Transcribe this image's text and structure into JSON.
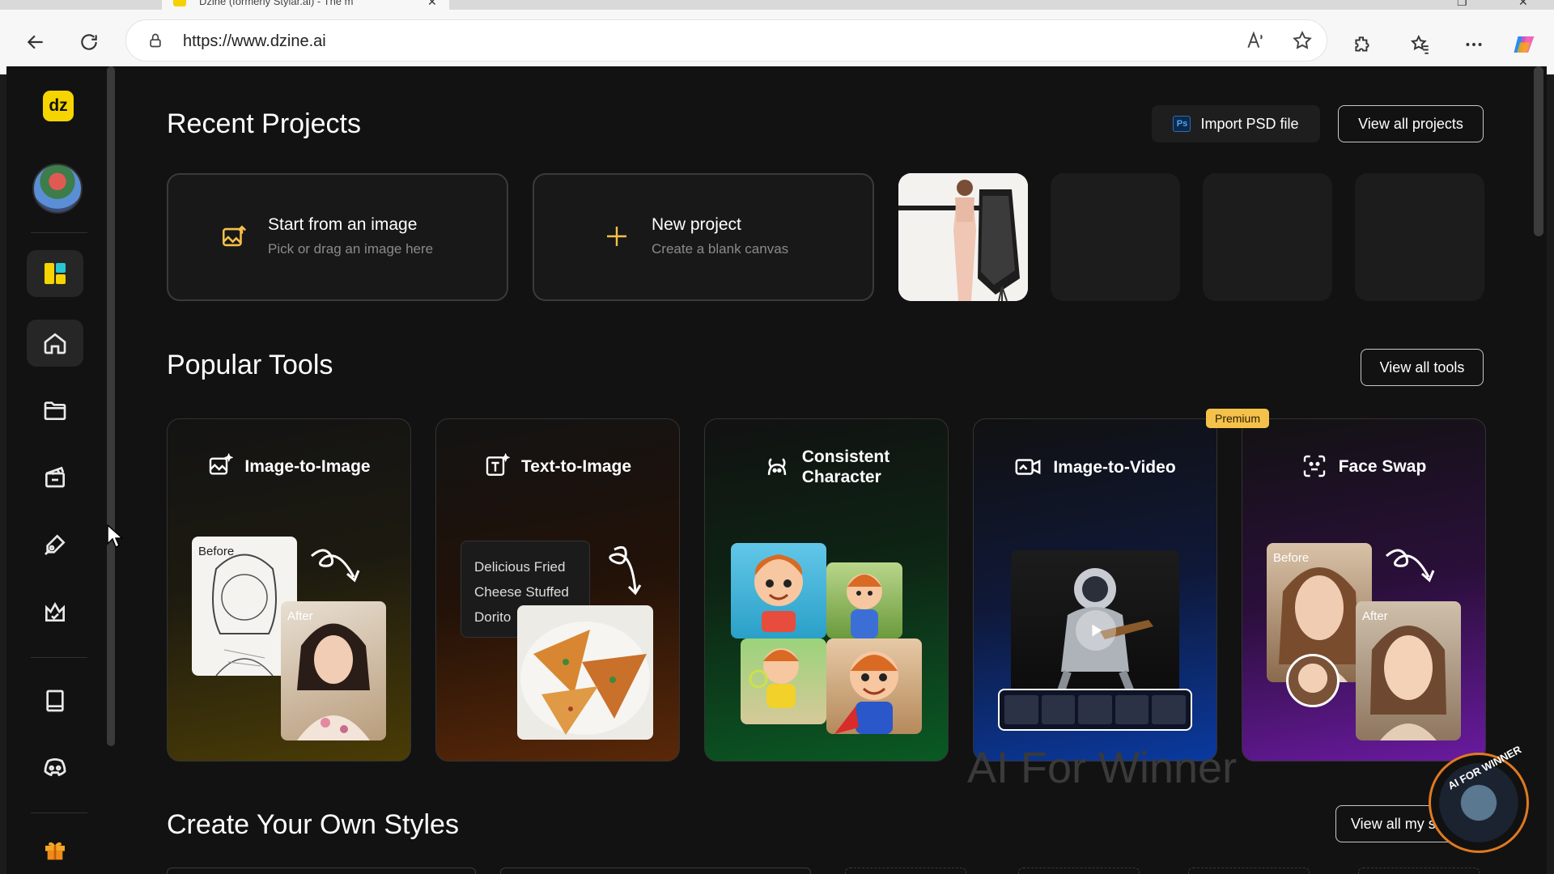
{
  "browser": {
    "tab_title": "Dzine (formerly Stylar.ai) - The m",
    "url": "https://www.dzine.ai"
  },
  "sidebar": {
    "logo": "dz",
    "items": [
      {
        "name": "canvas-app",
        "icon": "dzine-canvas-icon"
      },
      {
        "name": "home",
        "icon": "home-icon"
      },
      {
        "name": "projects",
        "icon": "folder-icon"
      },
      {
        "name": "tools",
        "icon": "clapperboard-icon"
      },
      {
        "name": "styles",
        "icon": "pen-tool-icon"
      },
      {
        "name": "community",
        "icon": "crown-icon"
      },
      {
        "name": "tutorials",
        "icon": "book-icon"
      },
      {
        "name": "discord",
        "icon": "discord-icon"
      },
      {
        "name": "gift",
        "icon": "gift-icon"
      }
    ]
  },
  "recent": {
    "title": "Recent Projects",
    "import_label": "Import PSD file",
    "import_badge": "Ps",
    "view_all": "View all projects",
    "start_title": "Start from an image",
    "start_sub": "Pick or drag an image here",
    "new_title": "New project",
    "new_sub": "Create a blank canvas"
  },
  "tools": {
    "title": "Popular Tools",
    "view_all": "View all tools",
    "premium": "Premium",
    "cards": [
      {
        "label": "Image-to-Image",
        "before": "Before",
        "after": "After"
      },
      {
        "label": "Text-to-Image",
        "prompt": [
          "Delicious Fried",
          "Cheese Stuffed",
          "Dorito"
        ]
      },
      {
        "label": "Consistent",
        "label2": "Character"
      },
      {
        "label": "Image-to-Video"
      },
      {
        "label": "Face Swap",
        "before": "Before",
        "after": "After"
      }
    ]
  },
  "styles": {
    "title": "Create Your Own Styles",
    "view_all": "View all my st"
  },
  "watermark": {
    "text": "AI For Winner",
    "badge": "AI FOR WINNER"
  },
  "colors": {
    "accent": "#f5d400",
    "premium": "#f4c24a",
    "page_bg": "#121212"
  }
}
